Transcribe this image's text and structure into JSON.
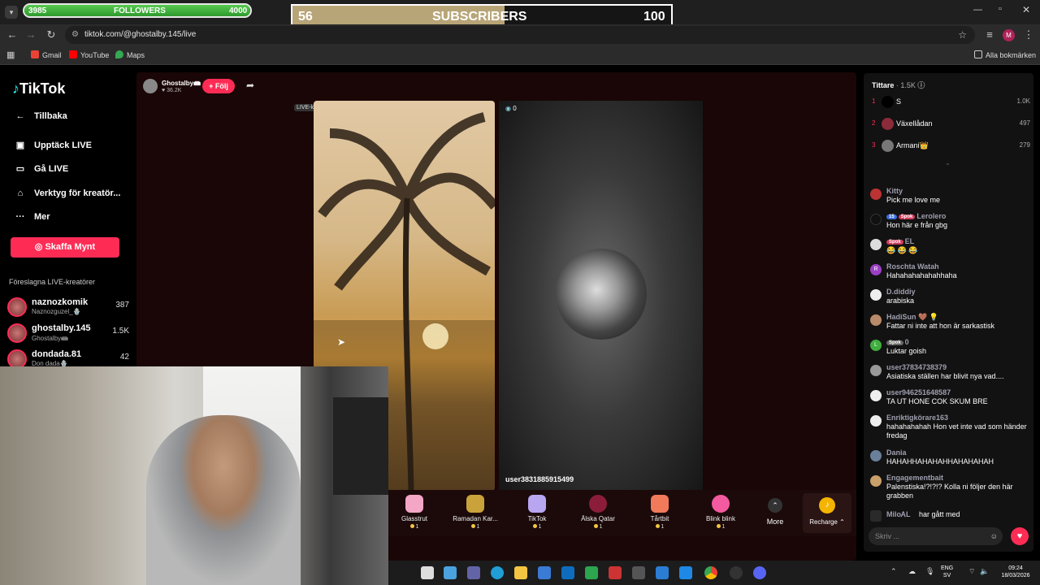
{
  "overlay": {
    "followers": {
      "current": "3985",
      "label": "FOLLOWERS",
      "goal": "4000",
      "fraction": 0.9963
    },
    "subscribers": {
      "current": "56",
      "label": "SUBSCRIBERS",
      "goal": "100",
      "fraction": 0.56
    }
  },
  "browser": {
    "url": "tiktok.com/@ghostalby.145/live",
    "bookmarks": [
      "Gmail",
      "YouTube",
      "Maps"
    ],
    "all_bookmarks": "Alla bokmärken",
    "profile_initial": "M"
  },
  "sidebar": {
    "logo": "TikTok",
    "back": "Tillbaka",
    "items": [
      "Upptäck LIVE",
      "Gå LIVE",
      "Verktyg för kreatör...",
      "Mer"
    ],
    "coins_button": "Skaffa Mynt",
    "suggested_title": "Föreslagna LIVE-kreatörer",
    "creators": [
      {
        "name": "naznozkomik",
        "sub": "Naznozguzel_🪬",
        "count": "387"
      },
      {
        "name": "ghostalby.145",
        "sub": "Ghostalby📾",
        "count": "1.5K"
      },
      {
        "name": "dondada.81",
        "sub": "Don dada🪬",
        "count": "42"
      }
    ]
  },
  "live": {
    "host_name": "Ghostalby📾",
    "host_likes": "36.2K",
    "follow_button": "+ Följ",
    "creator_tag": "LIVE-kreatör",
    "guest_count": "0",
    "guest_name": "user3831885915499"
  },
  "gifts": [
    {
      "name": "Glasstrut",
      "price": "1",
      "color": "#f4a6c6"
    },
    {
      "name": "Ramadan Kar...",
      "price": "1",
      "color": "#c9a23b"
    },
    {
      "name": "TikTok",
      "price": "1",
      "color": "#b9a6f0"
    },
    {
      "name": "Älska Qatar",
      "price": "1",
      "color": "#8b1d3b"
    },
    {
      "name": "Tårtbit",
      "price": "1",
      "color": "#f07a5a"
    },
    {
      "name": "Blink blink",
      "price": "1",
      "color": "#f45aa0"
    }
  ],
  "gift_more": "More",
  "recharge": "Recharge",
  "chat": {
    "viewers_label": "Tittare",
    "viewers_count": "1.5K",
    "ranking": [
      {
        "rank": "1",
        "user": "S",
        "count": "1.0K"
      },
      {
        "rank": "2",
        "user": "Växellådan",
        "count": "497"
      },
      {
        "rank": "3",
        "user": "Armani👑",
        "count": "279"
      }
    ],
    "messages": [
      {
        "user": "Kitty",
        "text": "Pick me love me",
        "color": "#b33"
      },
      {
        "user": "Lerolero",
        "badges": [
          "15",
          "Spok"
        ],
        "text": "Hon här e från gbg",
        "color": "#111"
      },
      {
        "user": "EL",
        "badges": [
          "Spok"
        ],
        "text": "😂 😂 😂",
        "color": "#ddd"
      },
      {
        "user": "Roschta Watah",
        "text": "Hahahahahahahhaha",
        "color": "#9b3fc4"
      },
      {
        "user": "D.diddiy",
        "text": "arabiska",
        "color": "#eee"
      },
      {
        "user": "HadiSun 🤎 💡",
        "text": "Fattar ni inte att hon är sarkastisk",
        "color": "#b98a6a"
      },
      {
        "user": "0",
        "badges": [
          "Spok"
        ],
        "text": "Luktar goish",
        "color": "#3fae3f"
      },
      {
        "user": "user37834738379",
        "text": "Asiatiska ställen har blivit nya vad....",
        "color": "#999"
      },
      {
        "user": "user946251648587",
        "text": "TA UT HONE COK SKUM BRE",
        "color": "#eee"
      },
      {
        "user": "Enriktigkörare163",
        "text": "hahahahahah Hon vet inte vad som händer fredag",
        "color": "#eee"
      },
      {
        "user": "Dania",
        "text": "HAHAHHAHAHAHHAHAHAHAH",
        "color": "#6a7f9a"
      },
      {
        "user": "Engagementbait",
        "text": "Palenstiska!?!?!? Kolla ni följer den här grabben",
        "color": "#c9a06a"
      },
      {
        "user": "MiloᎪL",
        "text": "har gått med",
        "color": "#444"
      }
    ],
    "input_placeholder": "Skriv ...",
    "tags": {
      "initial_r": "R",
      "initial_l": "L"
    }
  },
  "taskbar": {
    "lang": "ENG",
    "lang_sub": "SV",
    "time": "09:24",
    "date": "18/03/2026"
  }
}
